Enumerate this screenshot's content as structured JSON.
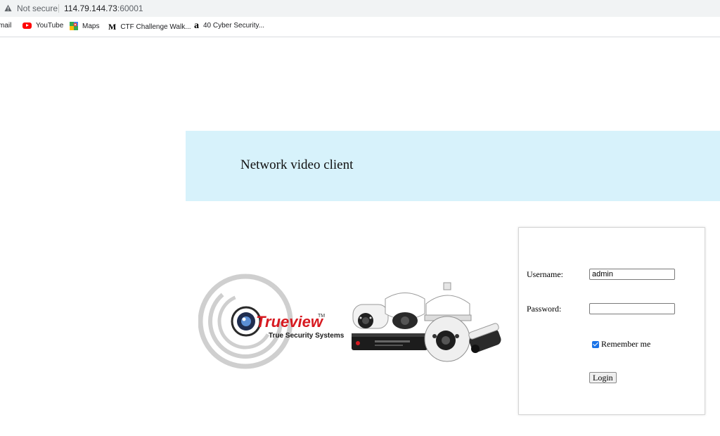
{
  "browser": {
    "security_label": "Not secure",
    "url_host": "114.79.144.73",
    "url_port": ":60001",
    "bookmarks": [
      {
        "label": "mail",
        "icon": "gmail-icon"
      },
      {
        "label": "YouTube",
        "icon": "youtube-icon"
      },
      {
        "label": "Maps",
        "icon": "maps-icon"
      },
      {
        "label": "CTF Challenge Walk...",
        "icon": "medium-icon"
      },
      {
        "label": "40 Cyber Security...",
        "icon": "amazon-icon"
      }
    ]
  },
  "page": {
    "title": "Network video client",
    "logo": {
      "brand": "Trueview",
      "trademark": "TM",
      "tagline": "True Security Systems"
    }
  },
  "login": {
    "username_label": "Username:",
    "username_value": "admin",
    "password_label": "Password:",
    "password_value": "",
    "remember_label": "Remember me",
    "remember_checked": true,
    "login_button": "Login"
  },
  "colors": {
    "banner_bg": "#d7f2fb",
    "brand_red": "#d71920",
    "checkbox_blue": "#1a73e8"
  }
}
